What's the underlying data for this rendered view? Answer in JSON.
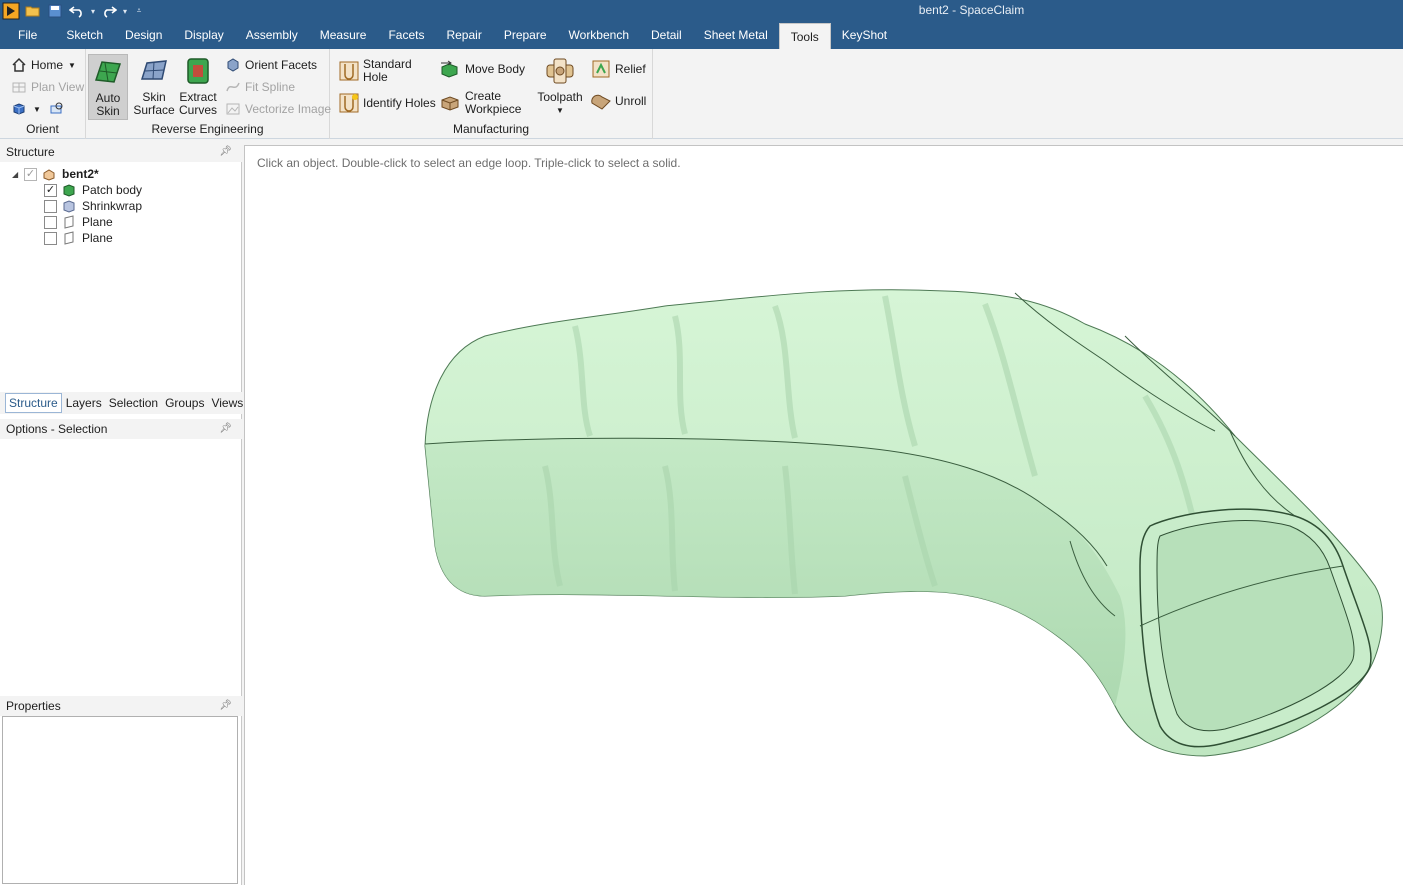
{
  "app": {
    "title": "bent2 - SpaceClaim",
    "accent": "#2b5b8a",
    "quick_access": [
      "app-logo-icon",
      "open-icon",
      "save-icon",
      "undo-icon",
      "redo-icon",
      "customize-icon"
    ]
  },
  "ribbon": {
    "tabs": [
      {
        "label": "File"
      },
      {
        "label": "Sketch"
      },
      {
        "label": "Design"
      },
      {
        "label": "Display"
      },
      {
        "label": "Assembly"
      },
      {
        "label": "Measure"
      },
      {
        "label": "Facets"
      },
      {
        "label": "Repair"
      },
      {
        "label": "Prepare"
      },
      {
        "label": "Workbench"
      },
      {
        "label": "Detail"
      },
      {
        "label": "Sheet Metal"
      },
      {
        "label": "Tools",
        "active": true
      },
      {
        "label": "KeyShot"
      }
    ],
    "orient": {
      "label": "Orient",
      "home": "Home",
      "plan_view": "Plan View"
    },
    "reverse_engineering": {
      "label": "Reverse Engineering",
      "auto_skin_1": "Auto",
      "auto_skin_2": "Skin",
      "skin_surface_1": "Skin",
      "skin_surface_2": "Surface",
      "extract_curves_1": "Extract",
      "extract_curves_2": "Curves",
      "orient_facets": "Orient Facets",
      "fit_spline": "Fit Spline",
      "vectorize_image": "Vectorize Image"
    },
    "manufacturing": {
      "label": "Manufacturing",
      "standard_hole_1": "Standard",
      "standard_hole_2": "Hole",
      "identify_holes": "Identify Holes",
      "move_body": "Move Body",
      "create_workpiece_1": "Create",
      "create_workpiece_2": "Workpiece",
      "toolpath": "Toolpath",
      "relief": "Relief",
      "unroll": "Unroll"
    }
  },
  "structure_panel": {
    "title": "Structure",
    "tree": {
      "root": "bent2*",
      "children": [
        {
          "label": "Patch body",
          "checked": true
        },
        {
          "label": "Shrinkwrap",
          "checked": false
        },
        {
          "label": "Plane",
          "checked": false
        },
        {
          "label": "Plane",
          "checked": false
        }
      ]
    },
    "tabs": [
      "Structure",
      "Layers",
      "Selection",
      "Groups",
      "Views"
    ]
  },
  "options_panel": {
    "title": "Options - Selection"
  },
  "properties_panel": {
    "title": "Properties"
  },
  "viewport": {
    "hint": "Click an object. Double-click to select an edge loop. Triple-click to select a solid.",
    "model_color": "#c4ecc6"
  }
}
